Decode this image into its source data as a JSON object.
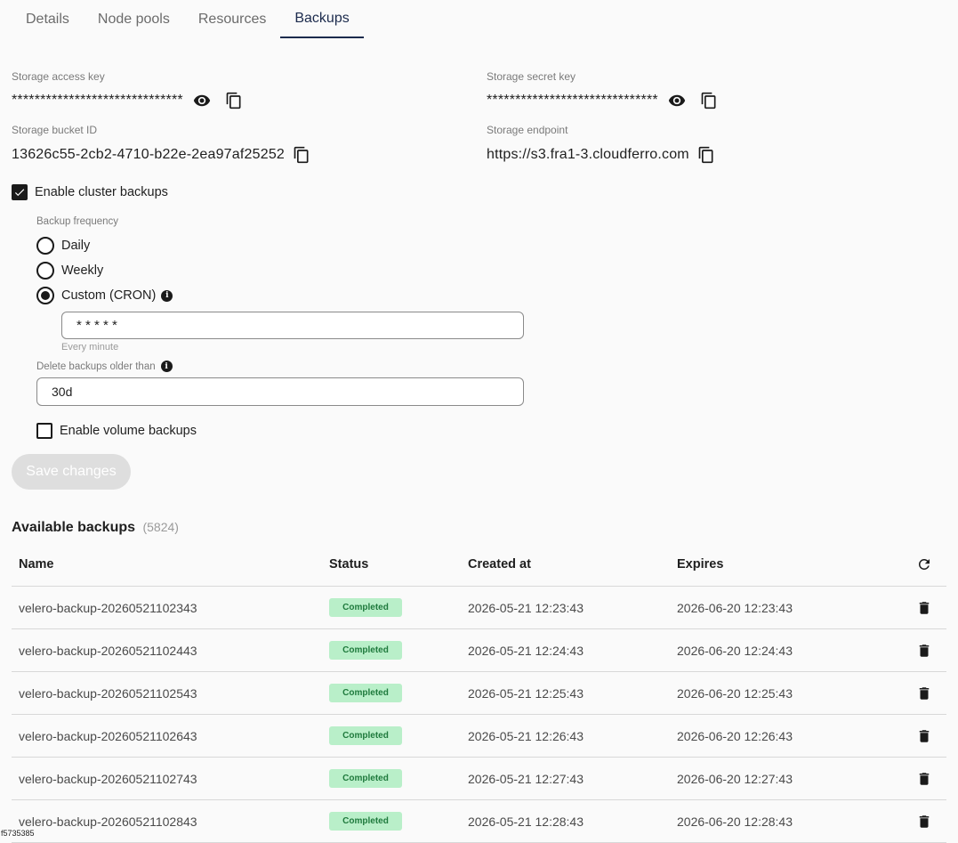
{
  "tabs": [
    {
      "label": "Details"
    },
    {
      "label": "Node pools"
    },
    {
      "label": "Resources"
    },
    {
      "label": "Backups"
    }
  ],
  "storage": {
    "access_key_label": "Storage access key",
    "access_key_value": "******************************",
    "secret_key_label": "Storage secret key",
    "secret_key_value": "******************************",
    "bucket_label": "Storage bucket ID",
    "bucket_value": "13626c55-2cb2-4710-b22e-2ea97af25252",
    "endpoint_label": "Storage endpoint",
    "endpoint_value": "https://s3.fra1-3.cloudferro.com"
  },
  "backup_settings": {
    "enable_cluster_label": "Enable cluster backups",
    "enable_cluster_checked": true,
    "frequency_label": "Backup frequency",
    "options": [
      {
        "label": "Daily",
        "selected": false
      },
      {
        "label": "Weekly",
        "selected": false
      },
      {
        "label": "Custom (CRON)",
        "selected": true
      }
    ],
    "cron_value": "* * * * *",
    "cron_hint": "Every minute",
    "delete_older_label": "Delete backups older than",
    "delete_older_value": "30d",
    "enable_volume_label": "Enable volume backups",
    "enable_volume_checked": false,
    "save_label": "Save changes"
  },
  "backups": {
    "title": "Available backups",
    "count": "(5824)",
    "columns": [
      "Name",
      "Status",
      "Created at",
      "Expires"
    ],
    "rows": [
      {
        "name": "velero-backup-20260521102343",
        "status": "Completed",
        "created": "2026-05-21 12:23:43",
        "expires": "2026-06-20 12:23:43"
      },
      {
        "name": "velero-backup-20260521102443",
        "status": "Completed",
        "created": "2026-05-21 12:24:43",
        "expires": "2026-06-20 12:24:43"
      },
      {
        "name": "velero-backup-20260521102543",
        "status": "Completed",
        "created": "2026-05-21 12:25:43",
        "expires": "2026-06-20 12:25:43"
      },
      {
        "name": "velero-backup-20260521102643",
        "status": "Completed",
        "created": "2026-05-21 12:26:43",
        "expires": "2026-06-20 12:26:43"
      },
      {
        "name": "velero-backup-20260521102743",
        "status": "Completed",
        "created": "2026-05-21 12:27:43",
        "expires": "2026-06-20 12:27:43"
      },
      {
        "name": "velero-backup-20260521102843",
        "status": "Completed",
        "created": "2026-05-21 12:28:43",
        "expires": "2026-06-20 12:28:43"
      }
    ]
  },
  "footer_id": "f5735385",
  "colors": {
    "accent": "#1c2b4d",
    "status_bg": "#b9efc9",
    "status_text": "#1f7a3d"
  }
}
